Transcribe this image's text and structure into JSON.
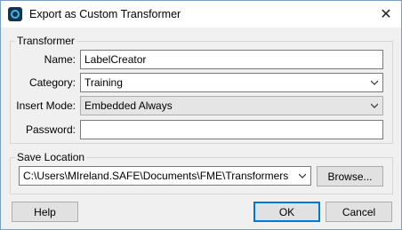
{
  "window": {
    "title": "Export as Custom Transformer",
    "close_glyph": "✕"
  },
  "transformer_group": {
    "title": "Transformer",
    "name": {
      "label": "Name:",
      "value": "LabelCreator"
    },
    "category": {
      "label": "Category:",
      "value": "Training"
    },
    "insert_mode": {
      "label": "Insert Mode:",
      "value": "Embedded Always"
    },
    "password": {
      "label": "Password:",
      "value": ""
    }
  },
  "save_group": {
    "title": "Save Location",
    "path": "C:\\Users\\MIreland.SAFE\\Documents\\FME\\Transformers",
    "browse_label": "Browse..."
  },
  "buttons": {
    "help": "Help",
    "ok": "OK",
    "cancel": "Cancel"
  },
  "icons": {
    "app": "fme-app-icon",
    "close": "close-icon",
    "dropdown": "chevron-down-icon"
  },
  "colors": {
    "default_button_border": "#0078d7",
    "app_icon_bg": "#17344f",
    "app_icon_ring": "#3fb7e8"
  }
}
